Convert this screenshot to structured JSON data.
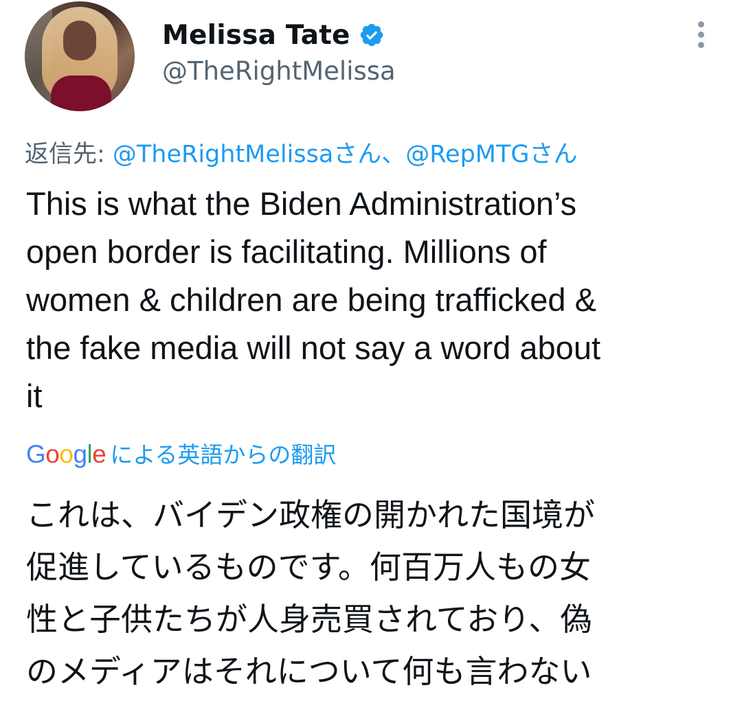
{
  "author": {
    "display_name": "Melissa Tate",
    "handle": "@TheRightMelissa",
    "verified": true,
    "avatar_icon": "profile-photo"
  },
  "menu": {
    "icon": "more-vertical-icon"
  },
  "reply_to": {
    "prefix": "返信先: ",
    "mention_1": "@TheRightMelissaさん",
    "separator": "、",
    "mention_2": "@RepMTGさん"
  },
  "tweet": {
    "text": "This is what the Biden Administration’s\nopen border is facilitating. Millions of\nwomen & children are being trafficked &\nthe fake media will not say a word about\nit"
  },
  "translation": {
    "google_logo_text": "Google",
    "label": "による英語からの翻訳",
    "text": "これは、バイデン政権の開かれた国境が\n促進しているものです。何百万人もの女\n性と子供たちが人身売買されており、偽\nのメディアはそれについて何も言わない"
  },
  "colors": {
    "link": "#1d9bf0",
    "secondary_text": "#536471",
    "primary_text": "#0f1419",
    "verified": "#1d9bf0"
  }
}
